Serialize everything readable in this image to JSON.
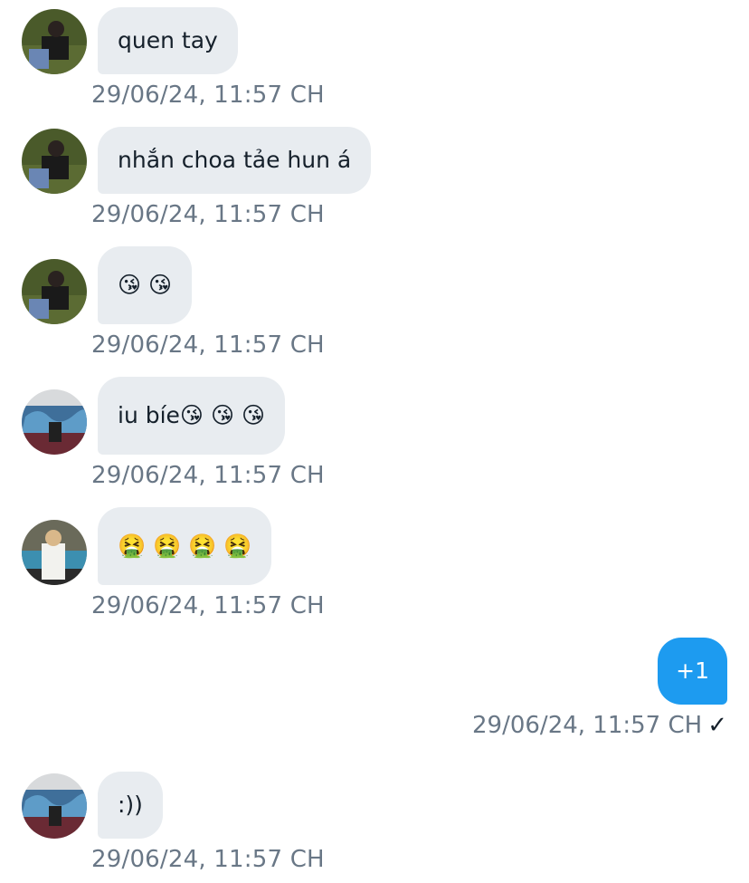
{
  "messages": [
    {
      "sender": "avatar-dark",
      "text": "quen tay",
      "timestamp": "29/06/24, 11:57 CH"
    },
    {
      "sender": "avatar-dark",
      "text": "nhắn choa tảe hun á",
      "timestamp": "29/06/24, 11:57 CH"
    },
    {
      "sender": "avatar-dark",
      "text": "😘 😘",
      "timestamp": "29/06/24, 11:57 CH"
    },
    {
      "sender": "avatar-graffiti",
      "text": "iu bíe😘 😘 😘",
      "timestamp": "29/06/24, 11:57 CH"
    },
    {
      "sender": "avatar-light",
      "text": "🤮 🤮 🤮 🤮",
      "timestamp": "29/06/24, 11:57 CH"
    }
  ],
  "outgoing": {
    "text": "+1",
    "timestamp": "29/06/24, 11:57 CH",
    "check": "✓"
  },
  "last_message": {
    "sender": "avatar-graffiti",
    "text": ":))",
    "timestamp": "29/06/24, 11:57 CH"
  },
  "colors": {
    "incoming_bubble": "#e8ecf0",
    "outgoing_bubble": "#1d9bf0",
    "timestamp": "#697786"
  }
}
